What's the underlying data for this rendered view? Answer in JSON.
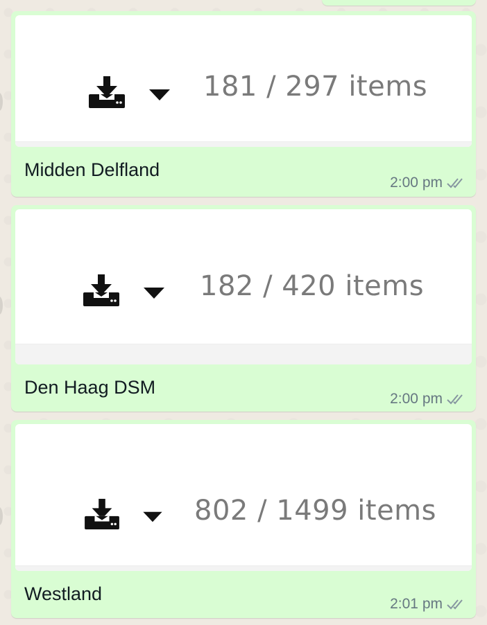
{
  "messages": [
    {
      "caption": "Midden Delfland",
      "count_text": "181 / 297 items",
      "time": "2:00 pm",
      "status_icon": "double-check-icon"
    },
    {
      "caption": "Den Haag DSM",
      "count_text": "182 / 420 items",
      "time": "2:00 pm",
      "status_icon": "double-check-icon"
    },
    {
      "caption": "Westland",
      "count_text": "802 / 1499 items",
      "time": "2:01 pm",
      "status_icon": "double-check-icon"
    }
  ],
  "icons": {
    "download": "download-icon",
    "dropdown": "caret-down-icon",
    "read_receipt": "double-check-icon"
  },
  "colors": {
    "bubble": "#d9fdd3",
    "chat_background": "#efeae2",
    "caption_text": "#111b21",
    "meta_text": "#667781",
    "count_text": "#7a7a7a"
  }
}
